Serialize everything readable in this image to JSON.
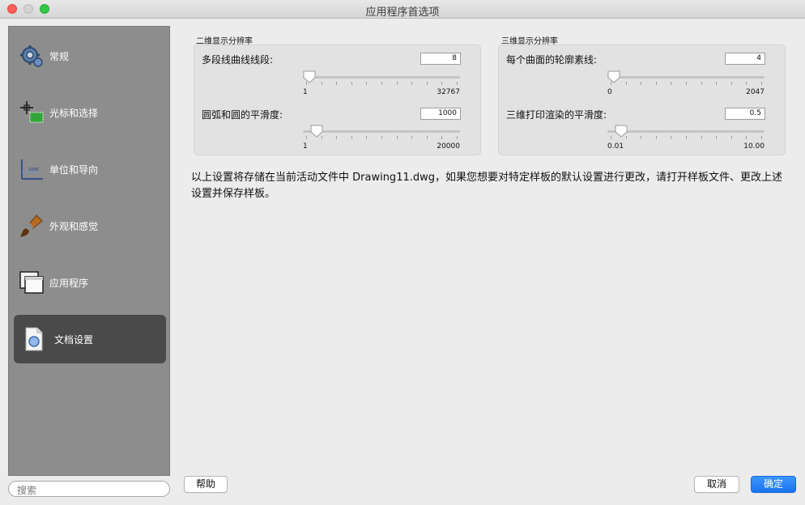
{
  "window": {
    "title": "应用程序首选项"
  },
  "sidebar": {
    "items": [
      {
        "label": "常规",
        "icon": "gear-icon"
      },
      {
        "label": "光标和选择",
        "icon": "cursor-selection-icon"
      },
      {
        "label": "单位和导向",
        "icon": "units-guides-icon"
      },
      {
        "label": "外观和感觉",
        "icon": "paintbrush-icon"
      },
      {
        "label": "应用程序",
        "icon": "windows-icon"
      },
      {
        "label": "文档设置",
        "icon": "document-icon",
        "active": true
      }
    ],
    "search_placeholder": "搜索"
  },
  "panel2d": {
    "title": "二维显示分辨率",
    "polyline": {
      "label": "多段线曲线线段:",
      "value": "8",
      "min": "1",
      "max": "32767",
      "level": 0.0
    },
    "arc": {
      "label": "圆弧和圆的平滑度:",
      "value": "1000",
      "min": "1",
      "max": "20000",
      "level": 0.05
    }
  },
  "panel3d": {
    "title": "三维显示分辨率",
    "contour": {
      "label": "每个曲面的轮廓素线:",
      "value": "4",
      "min": "0",
      "max": "2047",
      "level": 0.0
    },
    "plot": {
      "label": "三维打印渲染的平滑度:",
      "value": "0.5",
      "min": "0.01",
      "max": "10.00",
      "level": 0.05
    }
  },
  "note": "以上设置将存储在当前活动文件中 Drawing11.dwg，如果您想要对特定样板的默认设置进行更改，请打开样板文件、更改上述设置并保存样板。",
  "buttons": {
    "help": "帮助",
    "cancel": "取消",
    "ok": "确定"
  },
  "colors": {
    "accent": "#1a74f0",
    "sidebar": "#8d8d8d",
    "active": "#4a4a4a"
  }
}
